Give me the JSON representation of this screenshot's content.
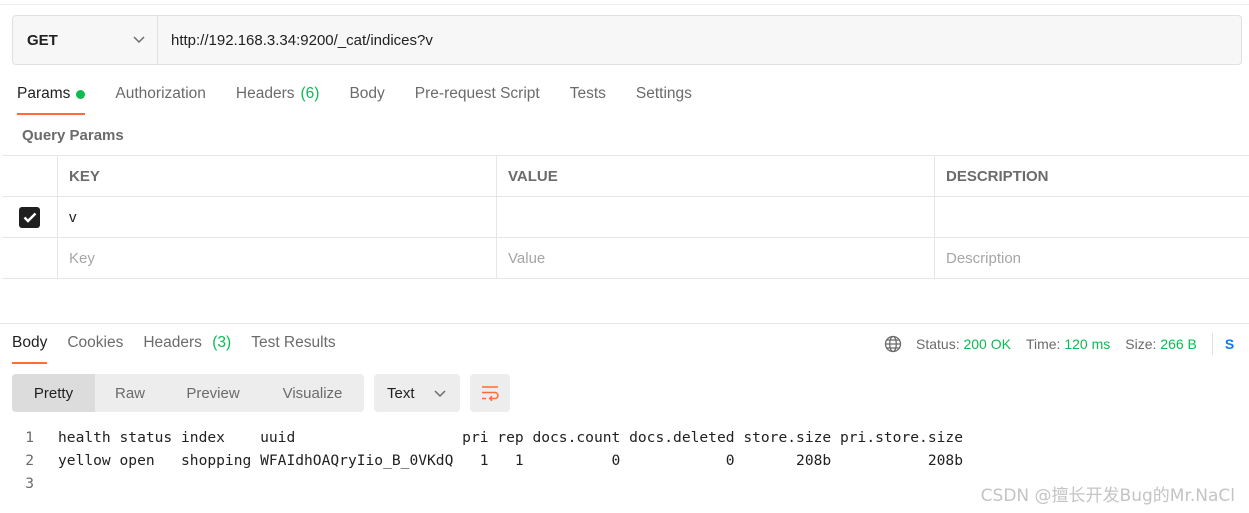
{
  "request": {
    "method": "GET",
    "url": "http://192.168.3.34:9200/_cat/indices?v"
  },
  "request_tabs": [
    {
      "label": "Params",
      "active": true,
      "indicator": "green-dot"
    },
    {
      "label": "Authorization"
    },
    {
      "label": "Headers",
      "count": "(6)"
    },
    {
      "label": "Body"
    },
    {
      "label": "Pre-request Script"
    },
    {
      "label": "Tests"
    },
    {
      "label": "Settings"
    }
  ],
  "query_params": {
    "title": "Query Params",
    "headers": [
      "KEY",
      "VALUE",
      "DESCRIPTION"
    ],
    "rows": [
      {
        "checked": true,
        "key": "v",
        "value": "",
        "description": ""
      }
    ],
    "placeholders": {
      "key": "Key",
      "value": "Value",
      "description": "Description"
    }
  },
  "response_tabs": [
    {
      "label": "Body",
      "active": true
    },
    {
      "label": "Cookies"
    },
    {
      "label": "Headers",
      "count": "(3)"
    },
    {
      "label": "Test Results"
    }
  ],
  "response_status": {
    "status_label": "Status:",
    "status_value": "200 OK",
    "time_label": "Time:",
    "time_value": "120 ms",
    "size_label": "Size:",
    "size_value": "266 B",
    "truncated_action": "S"
  },
  "view_modes": [
    "Pretty",
    "Raw",
    "Preview",
    "Visualize"
  ],
  "active_view": "Pretty",
  "format_select": "Text",
  "response_body": {
    "line_numbers": [
      "1",
      "2",
      "3"
    ],
    "lines": [
      "health status index    uuid                   pri rep docs.count docs.deleted store.size pri.store.size",
      "yellow open   shopping WFAIdhOAQryIio_B_0VKdQ   1   1          0            0       208b           208b",
      ""
    ]
  },
  "watermark": "CSDN @擅长开发Bug的Mr.NaCl",
  "colors": {
    "accent": "#ff6c37",
    "success": "#0cbb52",
    "link": "#097bed"
  }
}
